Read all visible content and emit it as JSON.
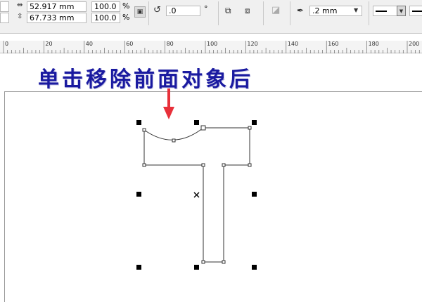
{
  "toolbar": {
    "width_value": "52.917 mm",
    "height_value": "67.733 mm",
    "scale_x": "100.0",
    "scale_y": "100.0",
    "percent_symbol": "%",
    "rotation_value": ".0",
    "degree_symbol": "°",
    "outline_width": ".2 mm",
    "icons": {
      "width": "width-arrows-icon",
      "height": "height-arrows-icon",
      "lock": "lock-ratio-icon",
      "rotate": "rotate-icon",
      "mirror_h": "mirror-horizontal-icon",
      "mirror_v": "mirror-vertical-icon",
      "convert": "convert-to-curves-icon",
      "pen": "outline-pen-icon"
    }
  },
  "ruler": {
    "labels": [
      "0",
      "20",
      "40",
      "60",
      "80",
      "100",
      "120",
      "140",
      "160",
      "180",
      "200"
    ]
  },
  "caption": "单击移除前面对象后",
  "colors": {
    "caption": "#1a1aa0",
    "arrow": "#e8303a",
    "toolbar_bg": "#f0f0f0"
  }
}
